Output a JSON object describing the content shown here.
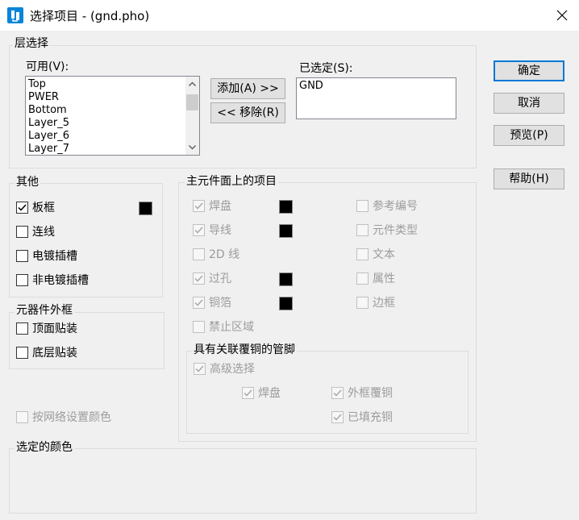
{
  "window": {
    "title": "选择项目 - (gnd.pho)"
  },
  "layer_select": {
    "group_label": "层选择",
    "available_label": "可用(V):",
    "available_items": [
      "Top",
      "PWER",
      "Bottom",
      "Layer_5",
      "Layer_6",
      "Layer_7"
    ],
    "add_button": "添加(A) >>",
    "remove_button": "<< 移除(R)",
    "selected_label": "已选定(S):",
    "selected_items": [
      "GND"
    ]
  },
  "buttons": {
    "ok": "确定",
    "cancel": "取消",
    "preview": "预览(P)",
    "help": "帮助(H)"
  },
  "other": {
    "group_label": "其他",
    "board_outline": {
      "label": "板框",
      "checked": true
    },
    "connections": {
      "label": "连线",
      "checked": false
    },
    "plated_slots": {
      "label": "电镀插槽",
      "checked": false
    },
    "nonplated_slots": {
      "label": "非电镀插槽",
      "checked": false
    }
  },
  "component_outline": {
    "group_label": "元器件外框",
    "top_mount": {
      "label": "顶面贴装",
      "checked": false
    },
    "bottom_mount": {
      "label": "底层贴装",
      "checked": false
    }
  },
  "main_items": {
    "group_label": "主元件面上的项目",
    "pads": {
      "label": "焊盘",
      "checked": true
    },
    "traces": {
      "label": "导线",
      "checked": true
    },
    "lines_2d": {
      "label": "2D 线",
      "checked": false
    },
    "vias": {
      "label": "过孔",
      "checked": true
    },
    "copper": {
      "label": "铜箔",
      "checked": true
    },
    "keepout": {
      "label": "禁止区域",
      "checked": false
    },
    "ref_des": {
      "label": "参考编号",
      "checked": false
    },
    "part_type": {
      "label": "元件类型",
      "checked": false
    },
    "text": {
      "label": "文本",
      "checked": false
    },
    "attributes": {
      "label": "属性",
      "checked": false
    },
    "outline": {
      "label": "边框",
      "checked": false
    }
  },
  "pins_group": {
    "group_label": "具有关联覆铜的管脚",
    "advanced": {
      "label": "高级选择",
      "checked": true
    },
    "pads": {
      "label": "焊盘",
      "checked": true
    },
    "outline_copper": {
      "label": "外框覆铜",
      "checked": true
    },
    "filled_copper": {
      "label": "已填充铜",
      "checked": true
    }
  },
  "net_color": {
    "label": "按网络设置颜色",
    "checked": false
  },
  "selected_color": {
    "group_label": "选定的颜色"
  },
  "colors": {
    "swatch": "#000000",
    "accent": "#0078d7"
  }
}
